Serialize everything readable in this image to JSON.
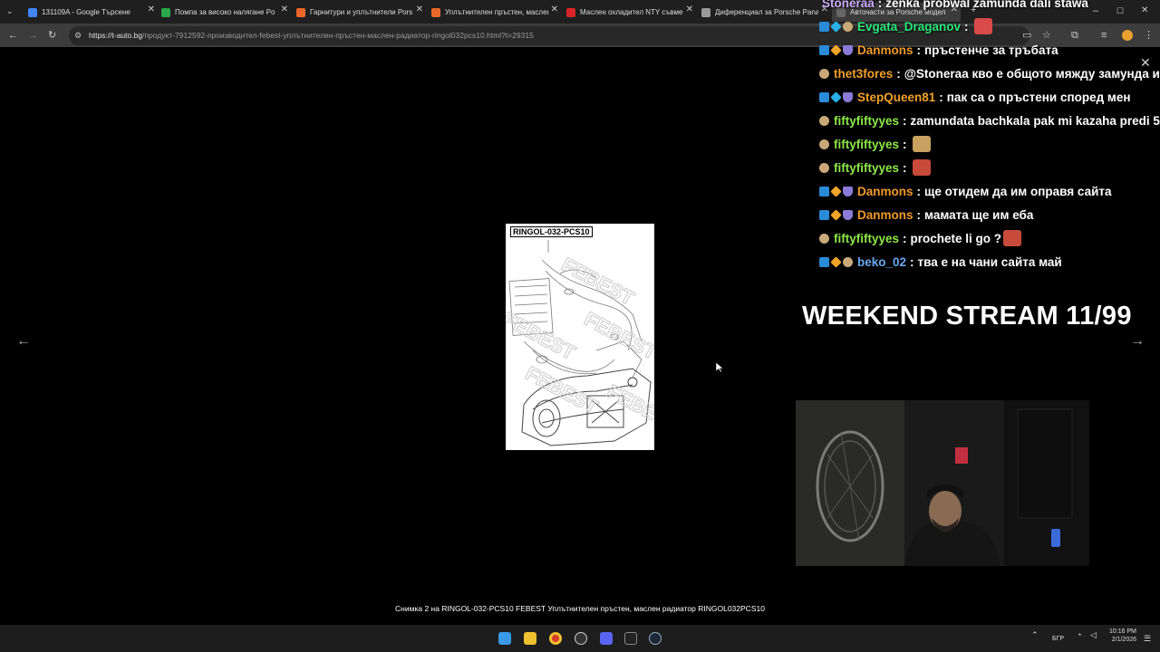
{
  "browser": {
    "tabs": [
      {
        "label": "131109A - Google Търсене",
        "favicon_color": "#4285f4"
      },
      {
        "label": "Помпа за високо налягане Po",
        "favicon_color": "#2aa84a"
      },
      {
        "label": "Гарнитури и уплътнители Pors",
        "favicon_color": "#e8672a"
      },
      {
        "label": "Уплътнителен пръстен, маслен",
        "favicon_color": "#e8672a"
      },
      {
        "label": "Маслен охладител NTY съвме",
        "favicon_color": "#d8252a"
      },
      {
        "label": "Диференциал за Porsche Panar",
        "favicon_color": "#999999"
      },
      {
        "label": "Авточасти за Porsche модел P",
        "favicon_color": "#666666"
      }
    ],
    "url": {
      "host": "https://t-auto.bg",
      "path": "/продукт-7912592-производител-febest-уплътнителен-пръстен-маслен-радиатор-ringol032pcs10.html?t=29315"
    },
    "window_controls": {
      "minimize": "–",
      "maximize": "☐",
      "close": "✕"
    }
  },
  "viewer": {
    "image_label": "RINGOL-032-PCS10",
    "watermark": "FEBEST",
    "caption": "Снимка 2 на RINGOL-032-PCS10 FEBEST Уплътнителен пръстен, маслен радиатор RINGOL032PCS10",
    "prev": "←",
    "next": "→"
  },
  "chat": {
    "close": "✕",
    "messages": [
      {
        "user": "Stoneraa",
        "color": "#c9a9f5",
        "text": "zenka probwal zamunda dali stawa",
        "badges": []
      },
      {
        "user": "Evgata_Draganov",
        "color": "#2ae87a",
        "text": "",
        "badges": [
          "prime",
          "gem",
          "face"
        ],
        "emote": "#d94a4a"
      },
      {
        "user": "Danmons",
        "color": "#f09a2a",
        "text": "пръстенче за тръбата",
        "badges": [
          "prime",
          "sub",
          "shield"
        ]
      },
      {
        "user": "thet3fores",
        "color": "#f0a02a",
        "text": "@Stoneraa кво е общото мяжду замунда и",
        "badges": [
          "face"
        ]
      },
      {
        "user": "StepQueen81",
        "color": "#f0a02a",
        "text": "пак са о пръстени според мен",
        "badges": [
          "prime",
          "gem",
          "shield"
        ]
      },
      {
        "user": "fiftyfiftyyes",
        "color": "#8ee84a",
        "text": "zamundata bachkala pak mi kazaha predi 5",
        "badges": [
          "face"
        ]
      },
      {
        "user": "fiftyfiftyyes",
        "color": "#8ee84a",
        "text": "",
        "badges": [
          "face"
        ],
        "emote": "#c8a060"
      },
      {
        "user": "fiftyfiftyyes",
        "color": "#8ee84a",
        "text": "",
        "badges": [
          "face"
        ],
        "emote": "#c84a3a"
      },
      {
        "user": "Danmons",
        "color": "#f09a2a",
        "text": "ще отидем да им оправя сайта",
        "badges": [
          "prime",
          "sub",
          "shield"
        ]
      },
      {
        "user": "Danmons",
        "color": "#f09a2a",
        "text": "мамата ще им еба",
        "badges": [
          "prime",
          "sub",
          "shield"
        ]
      },
      {
        "user": "fiftyfiftyyes",
        "color": "#8ee84a",
        "text": "prochete li go ?",
        "badges": [
          "face"
        ],
        "emote": "#c84a3a"
      },
      {
        "user": "beko_02",
        "color": "#6aa8f0",
        "text": "тва е на чани сайта май",
        "badges": [
          "prime",
          "sub",
          "face"
        ]
      }
    ]
  },
  "stream_title": "WEEKEND STREAM 11/99",
  "taskbar": {
    "tray_lang": "БГР",
    "time": "10:16 PM",
    "date": "2/1/2026"
  }
}
